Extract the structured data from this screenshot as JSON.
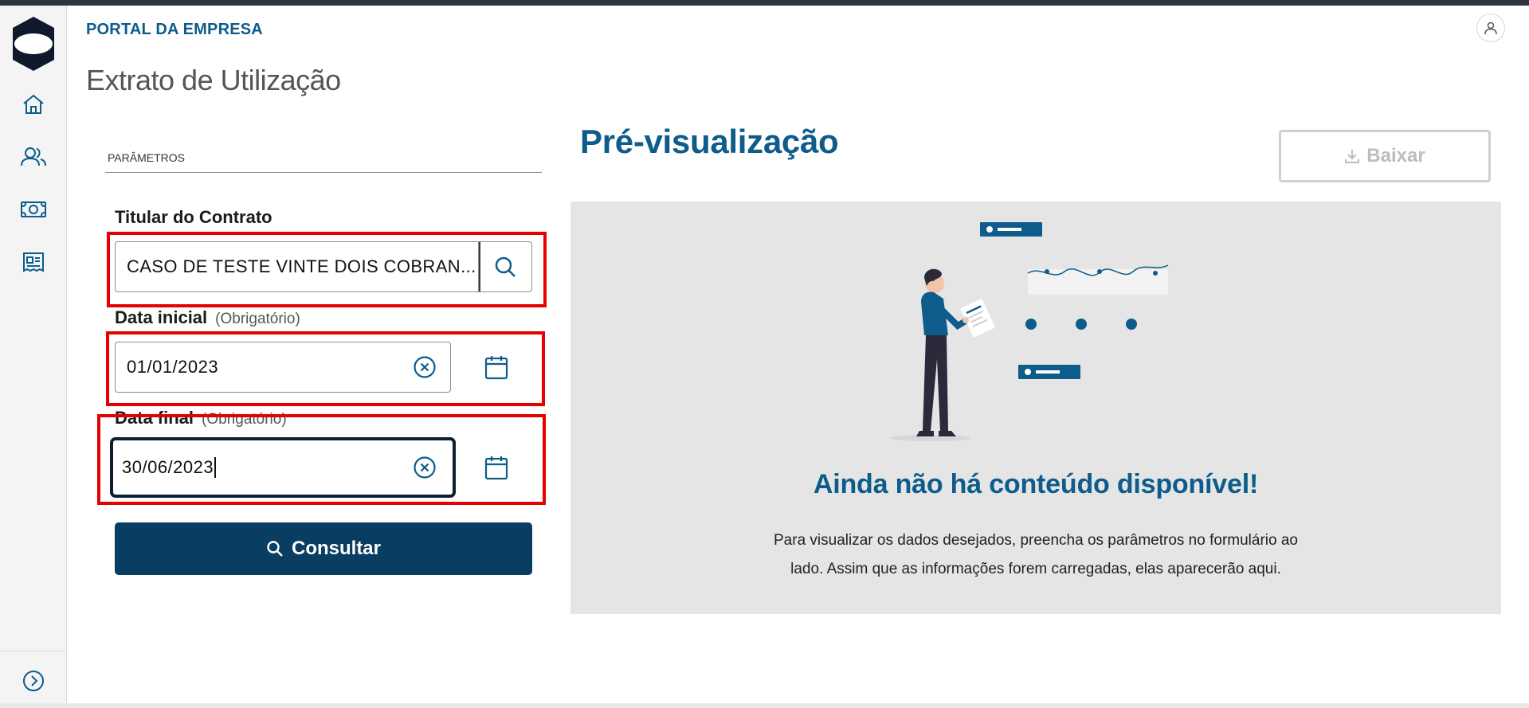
{
  "header": {
    "portal_label": "PORTAL DA EMPRESA",
    "page_title": "Extrato de Utilização",
    "user_icon": "user-icon"
  },
  "sidebar": {
    "items": [
      {
        "icon": "home-icon"
      },
      {
        "icon": "users-icon"
      },
      {
        "icon": "money-icon"
      },
      {
        "icon": "statement-icon"
      }
    ],
    "expand_icon": "chevron-right-circle-icon"
  },
  "params": {
    "section_label": "PARÂMETROS",
    "titular": {
      "label": "Titular do Contrato",
      "value": "CASO DE TESTE VINTE DOIS COBRAN..."
    },
    "data_inicial": {
      "label": "Data inicial",
      "required": "(Obrigatório)",
      "value": "01/01/2023"
    },
    "data_final": {
      "label": "Data final",
      "required": "(Obrigatório)",
      "value": "30/06/2023"
    },
    "consultar_label": "Consultar"
  },
  "preview": {
    "title": "Pré-visualização",
    "baixar_label": "Baixar",
    "empty_title": "Ainda não há conteúdo disponível!",
    "empty_line1": "Para visualizar os dados desejados, preencha os parâmetros no formulário ao",
    "empty_line2": "lado. Assim que as informações forem carregadas, elas aparecerão aqui."
  },
  "colors": {
    "brand_blue": "#0d5c8c",
    "button_navy": "#0a3d62",
    "highlight_red": "#e60000",
    "preview_bg": "#e5e5e5"
  }
}
